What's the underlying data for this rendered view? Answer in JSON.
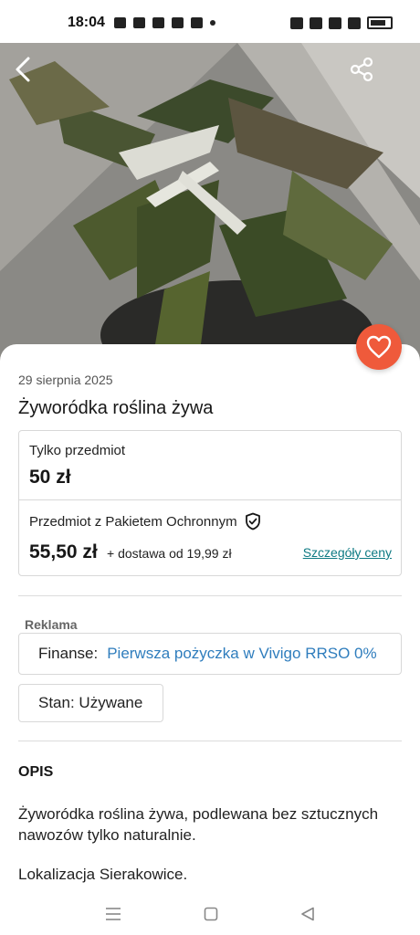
{
  "status_bar": {
    "time": "18:04"
  },
  "listing": {
    "date": "29 sierpnia 2025",
    "title": "Żyworódka roślina żywa"
  },
  "pricing": {
    "item_only_label": "Tylko przedmiot",
    "item_only_price": "50 zł",
    "protected_label": "Przedmiot z Pakietem Ochronnym",
    "protected_price": "55,50 zł",
    "shipping": "+ dostawa od 19,99 zł",
    "details_link": "Szczegóły ceny"
  },
  "ad": {
    "label": "Reklama",
    "prefix": "Finanse:",
    "link": "Pierwsza pożyczka w Vivigo RRSO 0%"
  },
  "condition": "Stan: Używane",
  "description": {
    "heading": "OPIS",
    "text": "Żyworódka roślina żywa, podlewana bez sztucznych nawozów tylko naturalnie.",
    "location": "Lokalizacja Sierakowice."
  },
  "icons": {
    "back": "back-arrow-icon",
    "share": "share-icon",
    "favorite": "heart-icon",
    "protection": "shield-check-icon"
  },
  "colors": {
    "accent": "#0e7a83",
    "favorite_bg": "#ef5a3b",
    "ad_link": "#2f7dbd"
  }
}
